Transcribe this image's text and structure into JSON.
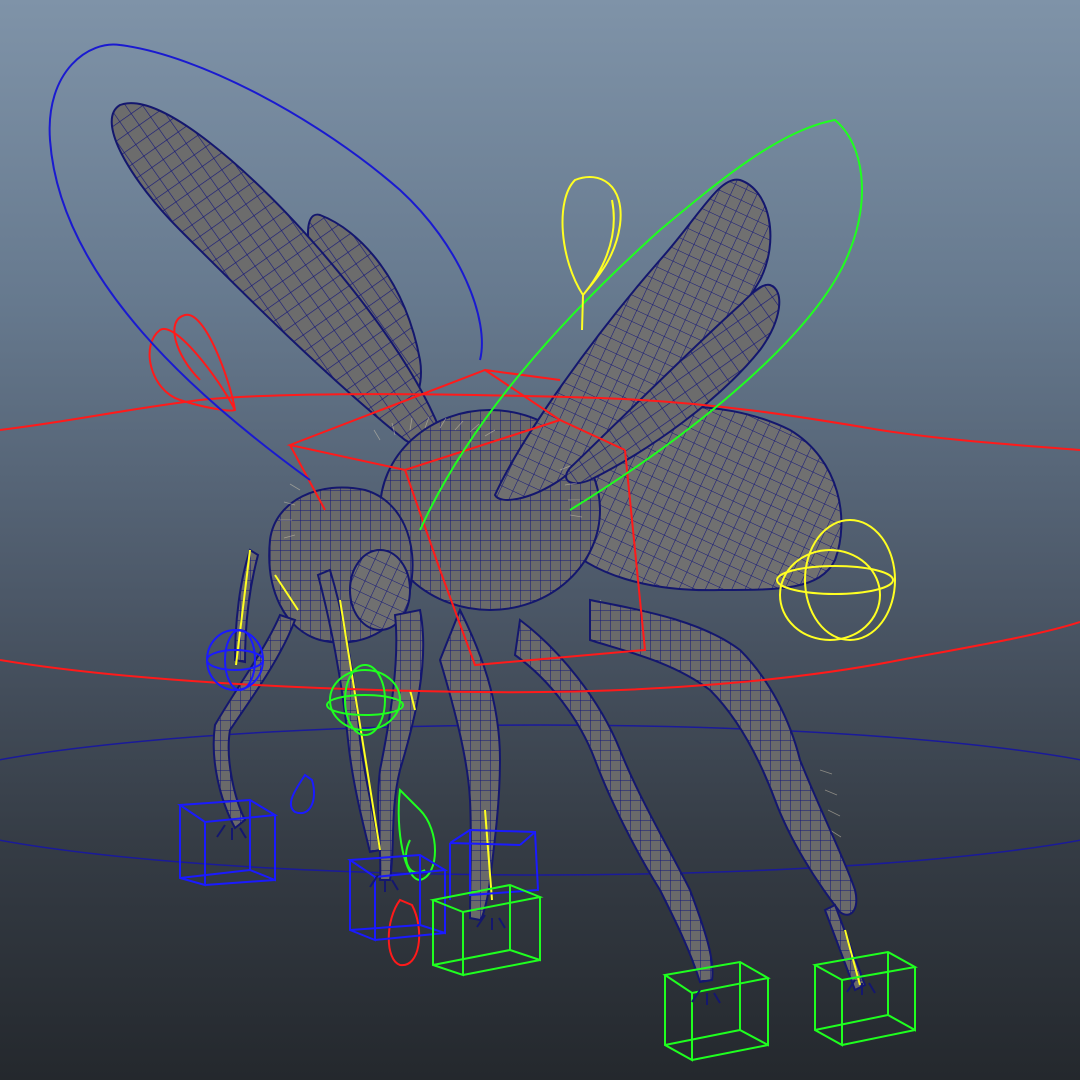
{
  "viewport": {
    "background_top": "#7f93a8",
    "background_bottom": "#24282d",
    "mesh_color": "#6e6e6e",
    "wireframe_color": "#14176e"
  },
  "rig_controls": {
    "colors": {
      "red": "#ff1a1a",
      "blue": "#1a1aff",
      "green": "#1fff1f",
      "yellow": "#ffff22"
    },
    "items": [
      {
        "name": "left-wing-control",
        "color": "blue",
        "shape": "loop"
      },
      {
        "name": "right-wing-control",
        "color": "green",
        "shape": "loop"
      },
      {
        "name": "antenna-control",
        "color": "yellow",
        "shape": "teardrop"
      },
      {
        "name": "head-control",
        "color": "red",
        "shape": "teardrop"
      },
      {
        "name": "body-control",
        "color": "red",
        "shape": "box"
      },
      {
        "name": "root-control",
        "color": "red",
        "shape": "circle"
      },
      {
        "name": "world-control",
        "color": "blue",
        "shape": "circle"
      },
      {
        "name": "tail-control",
        "color": "yellow",
        "shape": "gimbal"
      },
      {
        "name": "front-left-foot-control",
        "color": "blue",
        "shape": "cube"
      },
      {
        "name": "front-right-foot-control",
        "color": "blue",
        "shape": "cube"
      },
      {
        "name": "mid-left-foot-control",
        "color": "green",
        "shape": "cube"
      },
      {
        "name": "mid-right-foot-control",
        "color": "green",
        "shape": "cube"
      },
      {
        "name": "back-foot-control",
        "color": "green",
        "shape": "cube"
      }
    ]
  }
}
